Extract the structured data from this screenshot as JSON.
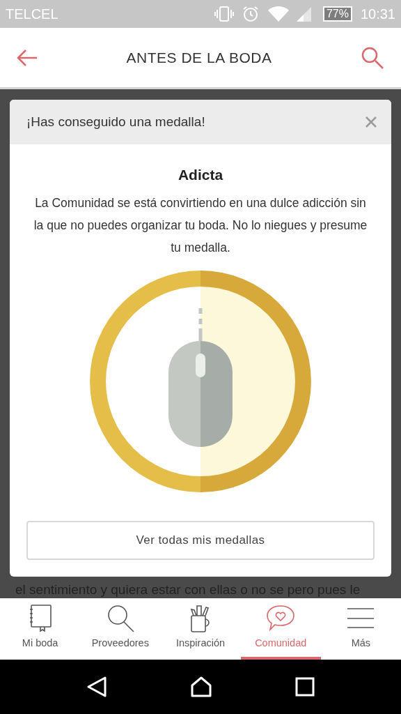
{
  "status_bar": {
    "carrier": "TELCEL",
    "battery": "77%",
    "time": "10:31"
  },
  "header": {
    "title": "ANTES DE LA BODA"
  },
  "background_text": "el sentimiento y quiera estar con ellas o no se pero pues le",
  "dialog": {
    "title": "¡Has conseguido una medalla!",
    "medal_name": "Adicta",
    "description": "La Comunidad se está convirtiendo en una dulce adicción sin la que no puedes organizar tu boda. No lo niegues y presume tu medalla.",
    "button": "Ver todas mis medallas"
  },
  "bottom_nav": [
    {
      "kind": "notebook",
      "label": "Mi boda",
      "selected": false
    },
    {
      "kind": "search",
      "label": "Proveedores",
      "selected": false
    },
    {
      "kind": "mug",
      "label": "Inspiración",
      "selected": false
    },
    {
      "kind": "heart",
      "label": "Comunidad",
      "selected": true
    },
    {
      "kind": "menu",
      "label": "Más",
      "selected": false
    }
  ]
}
